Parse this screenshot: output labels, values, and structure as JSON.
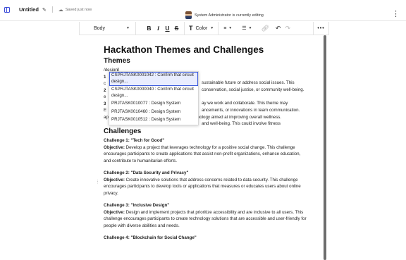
{
  "header": {
    "doc_title": "Untitled",
    "saved_status": "Saved just now",
    "editing_status": "System Administrator is currently editing",
    "more_label": "⋮"
  },
  "toolbar": {
    "paragraph_style": "Body",
    "bold": "B",
    "italic": "I",
    "underline": "U",
    "strike": "S",
    "color_label": "Color"
  },
  "doc": {
    "title": "Hackathon Themes and Challenges",
    "themes_heading": "Themes",
    "typed_text": "/design",
    "line_a_prefix": "1",
    "line_a_tail": "sustainable future or address social issues. This",
    "line_b_prefix": "c",
    "line_b_tail": "conservation, social justice, or community well-being.",
    "line_c_prefix": "2",
    "line_d_tail": "ay we work and collaborate. This theme may",
    "line_e_prefix": "e",
    "line_e_tail": "ancements, or innovations in team communication.",
    "line_f_prefix": "3",
    "line_g_prefix": "E",
    "line_g_tail": "and well-being. This could involve fitness",
    "line_h": "applications, mental health support tools, or technology aimed at improving overall wellness.",
    "challenges_heading": "Challenges",
    "challenges": [
      {
        "title": "Challenge 1: \"Tech for Good\"",
        "objective_label": "Objective:",
        "objective": " Develop a project that leverages technology for a positive social change. This challenge encourages participants to create applications that assist non-profit organizations, enhance education, and contribute to humanitarian efforts."
      },
      {
        "title": "Challenge 2: \"Data Security and Privacy\"",
        "objective_label": "Objective:",
        "objective": " Create innovative solutions that address concerns related to data security. This challenge encourages participants to develop tools or applications that measures or educates users about online privacy."
      },
      {
        "title": "Challenge 3: \"Inclusive Design\"",
        "objective_label": "Objective:",
        "objective": " Design and implement projects that prioritize accessibility and are inclusive to all users. This challenge encourages participants to create technology solutions that are accessible and user-friendly for people with diverse abilities and needs."
      },
      {
        "title": "Challenge 4: \"Blockchain for Social Change\""
      }
    ]
  },
  "dropdown": {
    "items": [
      "CSPRJTASK0001042 : Confirm that circuit design...",
      "CSPRJTASK0000040 : Confirm that circuit design...",
      "PRJTASK0010077 : Design System",
      "PRJTASK0010460 : Design System",
      "PRJTASK0010512 : Design System"
    ],
    "selected_index": 0
  },
  "colors": {
    "accent": "#3c5bdc",
    "selected_bg": "#e9edff",
    "scrollbar": "#6d6d6d"
  }
}
